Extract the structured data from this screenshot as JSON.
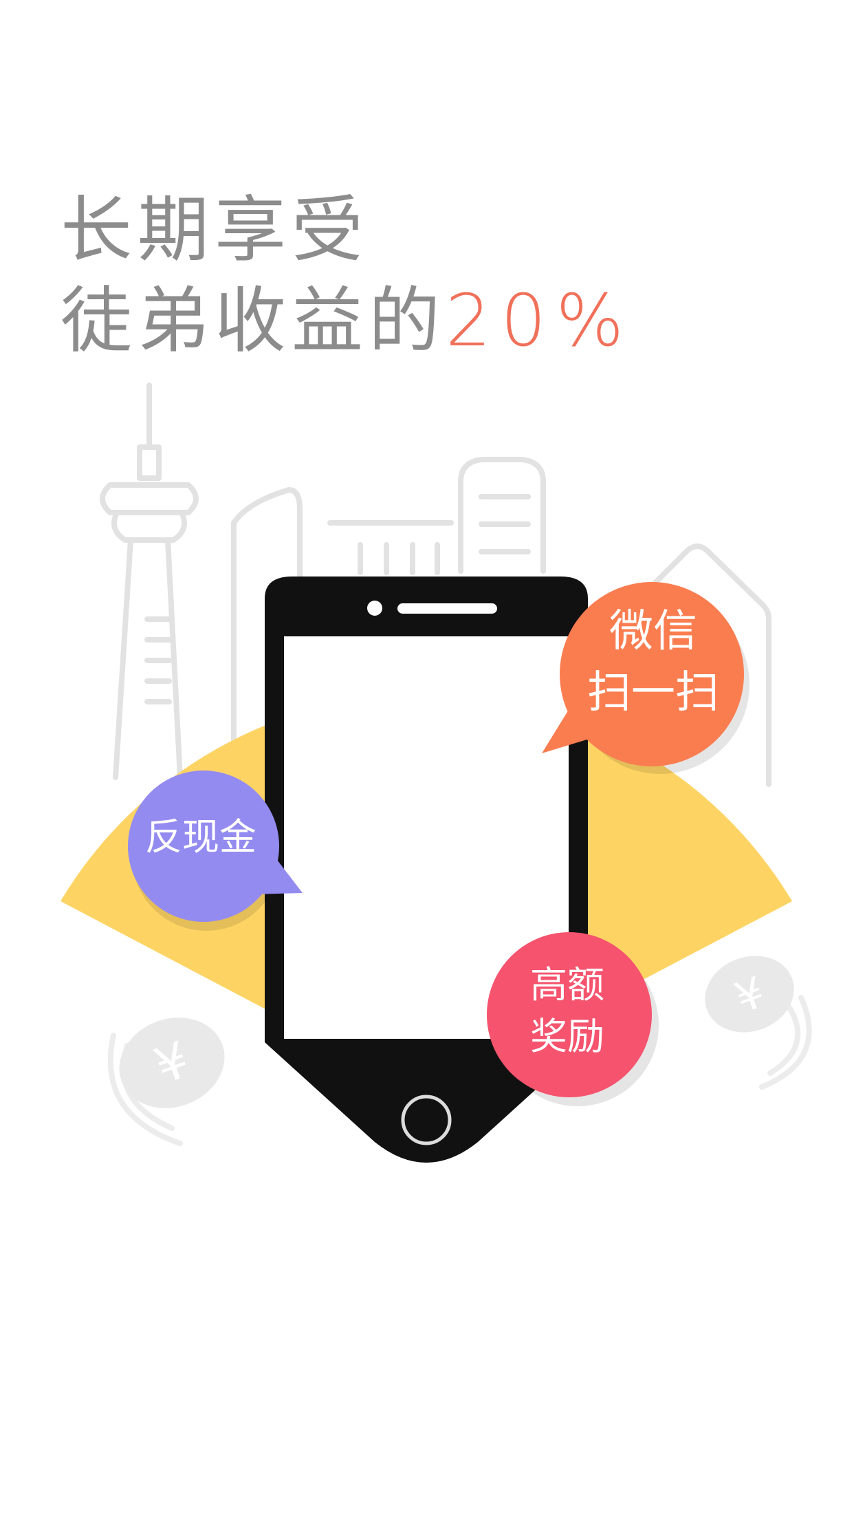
{
  "headline": {
    "line1": "长期享受",
    "line2_prefix": "徒弟收益的",
    "line2_highlight": "20%"
  },
  "bubbles": {
    "wechat": {
      "line1": "微信",
      "line2": "扫一扫"
    },
    "cashback": {
      "label": "反现金"
    },
    "reward": {
      "line1": "高额",
      "line2": "奖励"
    }
  },
  "colors": {
    "headline_text": "#8c8c8c",
    "highlight": "#f0705a",
    "fan_background": "#fdd464",
    "skyline_outline": "#e2e2e2",
    "phone_body": "#111111",
    "bubble_wechat": "#fa7d50",
    "bubble_cashback": "#948bf0",
    "bubble_reward": "#f5536e",
    "coin": "#e9e9e9"
  },
  "icons": {
    "coins": "yuan-coin-icon",
    "phone": "smartphone-illustration"
  }
}
